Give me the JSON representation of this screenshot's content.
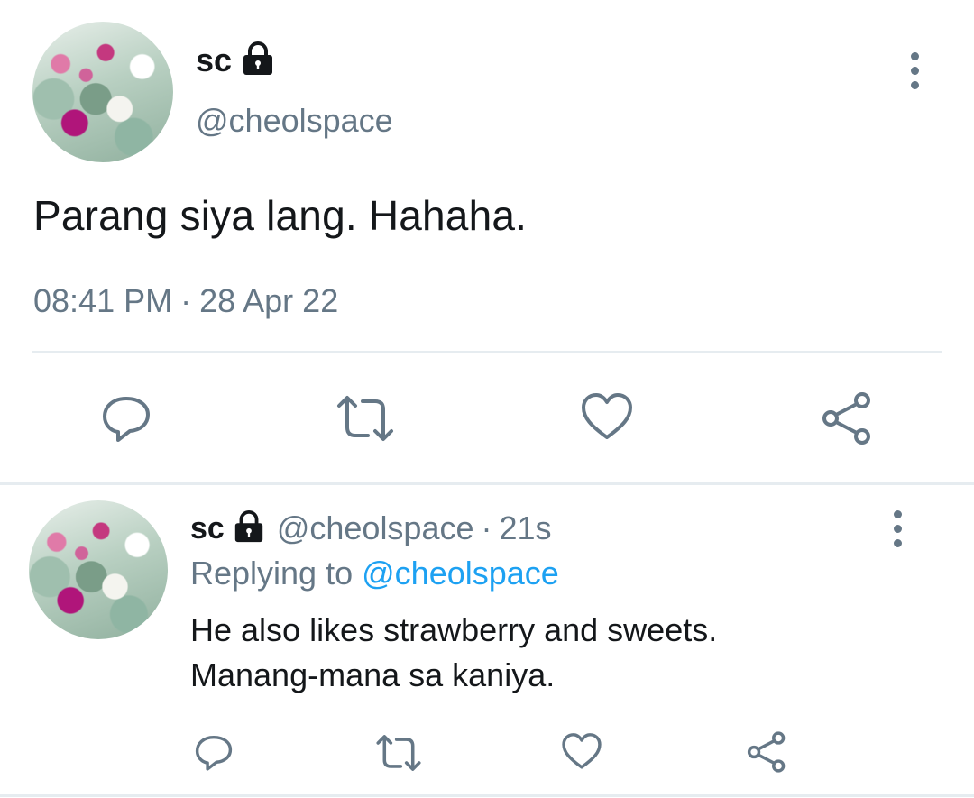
{
  "main_tweet": {
    "author_name": "sc",
    "handle": "@cheolspace",
    "text": "Parang siya lang. Hahaha.",
    "time": "08:41 PM",
    "separator": "·",
    "date": "28 Apr 22",
    "icons": [
      "avatar",
      "lock-icon",
      "more-options-icon",
      "reply-icon",
      "retweet-icon",
      "like-icon",
      "share-icon"
    ]
  },
  "reply_tweet": {
    "author_name": "sc",
    "handle": "@cheolspace",
    "separator": "·",
    "age": "21s",
    "replying_to_label": "Replying to",
    "replying_to_handle": "@cheolspace",
    "text_line1": "He also likes strawberry and sweets.",
    "text_line2": "Manang-mana sa kaniya.",
    "icons": [
      "avatar",
      "lock-icon",
      "more-options-icon",
      "reply-icon",
      "retweet-icon",
      "like-icon",
      "share-icon"
    ]
  },
  "colors": {
    "text_primary": "#14171a",
    "text_secondary": "#657786",
    "link": "#1da1f2",
    "divider": "#e6ecf0"
  }
}
